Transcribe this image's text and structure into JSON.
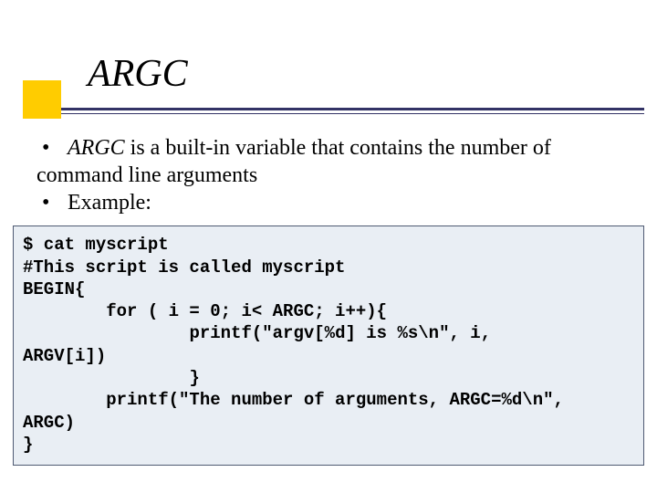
{
  "title": "ARGC",
  "bullets": {
    "b1_prefix": "ARGC",
    "b1_rest": " is a built-in variable that contains the number of",
    "b1_cont": "command line arguments",
    "b2": "Example:"
  },
  "code": {
    "l1": "$ cat myscript",
    "l2": "#This script is called myscript",
    "l3": "BEGIN{",
    "l4": "        for ( i = 0; i< ARGC; i++){",
    "l5": "                printf(\"argv[%d] is %s\\n\", i,",
    "l6": "ARGV[i])",
    "l7": "                }",
    "l8": "        printf(\"The number of arguments, ARGC=%d\\n\",",
    "l9": "ARGC)",
    "l10": "}"
  }
}
